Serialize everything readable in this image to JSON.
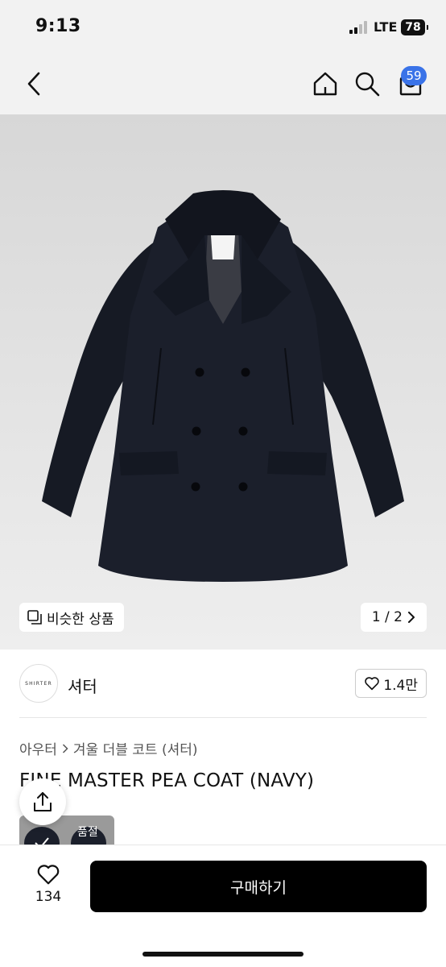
{
  "status_bar": {
    "time": "9:13",
    "network": "LTE",
    "battery": "78"
  },
  "nav": {
    "cart_count": "59"
  },
  "gallery": {
    "similar_label": "비슷한 상품",
    "page_indicator": "1 / 2"
  },
  "seller": {
    "logo_text": "SHIRTER",
    "name": "셔터",
    "like_count": "1.4만"
  },
  "breadcrumb": {
    "category": "아우터",
    "subcategory": "겨울 더블 코트 (셔터)"
  },
  "product": {
    "title": "FINE MASTER PEA COAT (NAVY)"
  },
  "thumbnail": {
    "text": "품절"
  },
  "bottom": {
    "wish_count": "134",
    "buy_label": "구매하기"
  }
}
